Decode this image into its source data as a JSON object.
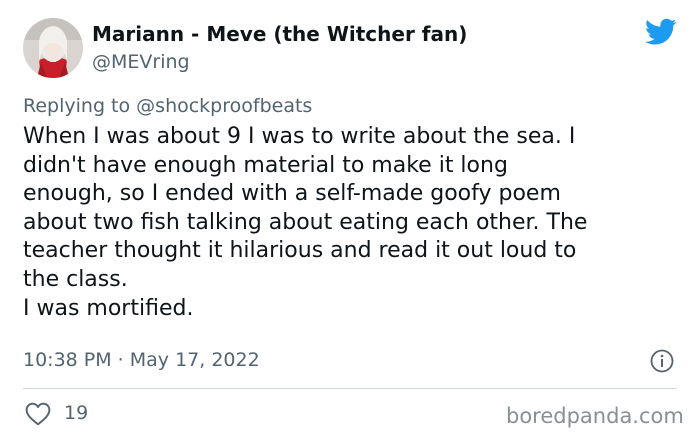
{
  "author": {
    "display_name": "Mariann - Meve (the Witcher fan)",
    "handle": "@MEVring",
    "avatar_icon": "profile-photo"
  },
  "platform_icon": "twitter-bird-icon",
  "reply": {
    "prefix": "Replying to",
    "mention": "@shockproofbeats"
  },
  "tweet": {
    "lines": [
      "When I was about 9 I was to write about the sea. I",
      "didn't have enough material to make it long",
      "enough, so I ended with a self-made goofy poem",
      "about two fish talking about eating each other. The",
      "teacher thought it hilarious and read it out loud to",
      "the class.",
      "I was mortified."
    ]
  },
  "timestamp": "10:38 PM · May 17, 2022",
  "engagement": {
    "likes": "19"
  },
  "watermark": "boredpanda.com",
  "colors": {
    "twitter_blue": "#1d9bf0",
    "text_primary": "#0f1419",
    "text_secondary": "#536471",
    "divider": "#cfd9de"
  }
}
